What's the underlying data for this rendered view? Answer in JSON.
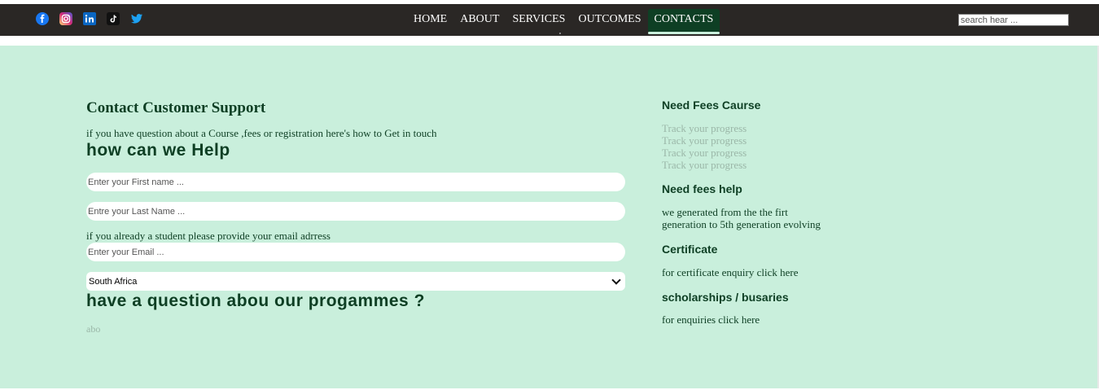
{
  "nav": {
    "social": [
      {
        "name": "facebook-icon",
        "color": "#1877f2"
      },
      {
        "name": "instagram-icon",
        "color": "#e1306c"
      },
      {
        "name": "linkedin-icon",
        "color": "#0a66c2"
      },
      {
        "name": "tiktok-icon",
        "color": "#000000"
      },
      {
        "name": "twitter-icon",
        "color": "#1da1f2"
      }
    ],
    "links": [
      {
        "label": "HOME",
        "active": false
      },
      {
        "label": "ABOUT",
        "active": false
      },
      {
        "label": "SERVICES",
        "active": false
      },
      {
        "label": "OUTCOMES",
        "active": false
      },
      {
        "label": "CONTACTS",
        "active": true
      }
    ],
    "search_placeholder": "search hear ..."
  },
  "contact": {
    "title": "Contact Customer Support",
    "intro": "if you have question about a Course ,fees or registration here's how to Get in touch",
    "help_heading": "how can we Help",
    "first_name_placeholder": "Enter your First name ...",
    "last_name_placeholder": "Entre your Last Name ...",
    "student_hint": "if you already a student please provide your email adrress",
    "email_placeholder": "Enter your Email ...",
    "country_selected": "South Africa",
    "question_heading": "have a question abou our progammes ?",
    "textarea_placeholder": "abo"
  },
  "sidebar": {
    "fees_course_heading": "Need Fees Caurse",
    "track_items": [
      "Track your progress",
      "Track your progress",
      "Track your progress",
      "Track your progress"
    ],
    "fees_help_heading": "Need fees help",
    "fees_help_line1": "we generated from the the firt",
    "fees_help_line2": "generation to 5th generation evolving",
    "certificate_heading": "Certificate",
    "certificate_text": "for certificate enquiry click here",
    "scholarships_heading": "scholarships / busaries",
    "scholarships_text": "for enquiries click here"
  },
  "colors": {
    "navbar": "#2a2725",
    "active_tab": "#0e3f24",
    "background": "#c9efdc",
    "heading_text": "#0e3f24"
  }
}
